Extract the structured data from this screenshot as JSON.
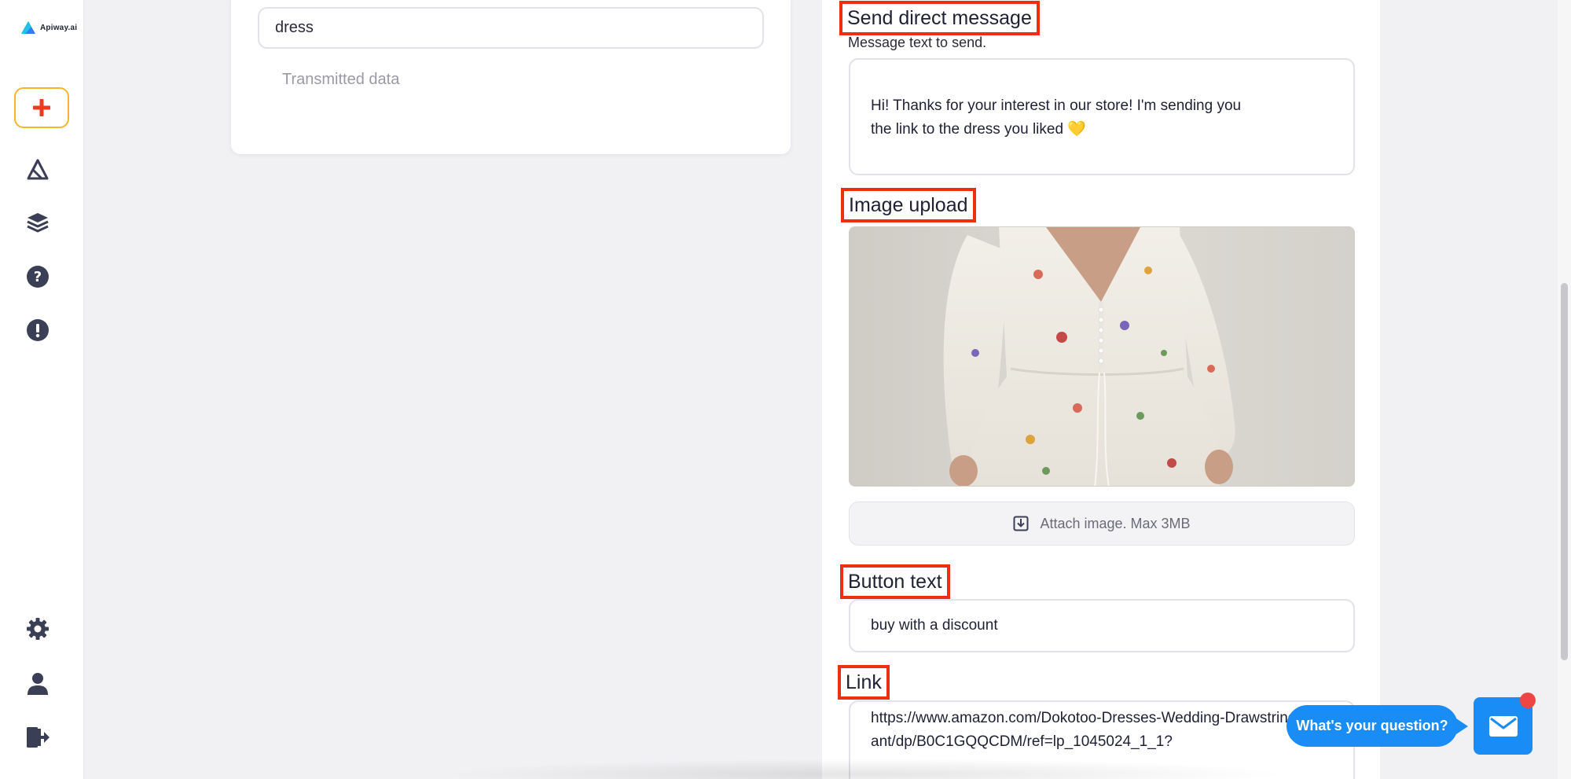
{
  "app": {
    "logo_text": "Apiway.ai",
    "accent_color": "#f5b52c",
    "highlight_color": "#ee2e10",
    "chat_color": "#1a8cf5"
  },
  "sidebar": {
    "items": [
      {
        "icon": "plus-icon"
      },
      {
        "icon": "automation-icon"
      },
      {
        "icon": "layers-icon"
      },
      {
        "icon": "help-icon"
      },
      {
        "icon": "alert-icon"
      },
      {
        "icon": "gear-icon"
      },
      {
        "icon": "user-icon"
      },
      {
        "icon": "logout-icon"
      }
    ]
  },
  "left_card": {
    "keyword_value": "dress",
    "transmitted_label": "Transmitted data"
  },
  "right_panel": {
    "send_dm_label": "Send direct message",
    "message_hint": "Message text to send.",
    "message_value": "Hi! Thanks for your interest in our store! I'm sending you\nthe link to the dress you liked 💛",
    "image_upload_label": "Image upload",
    "attach_label": "Attach image. Max 3MB",
    "button_text_label": "Button text",
    "button_text_value": "buy with a discount",
    "link_label": "Link",
    "link_value": "https://www.amazon.com/Dokotoo-Dresses-Wedding-Drawstring-Elegant/dp/B0C1GQQCDM/ref=lp_1045024_1_1?"
  },
  "chat": {
    "prompt": "What's your question?"
  }
}
